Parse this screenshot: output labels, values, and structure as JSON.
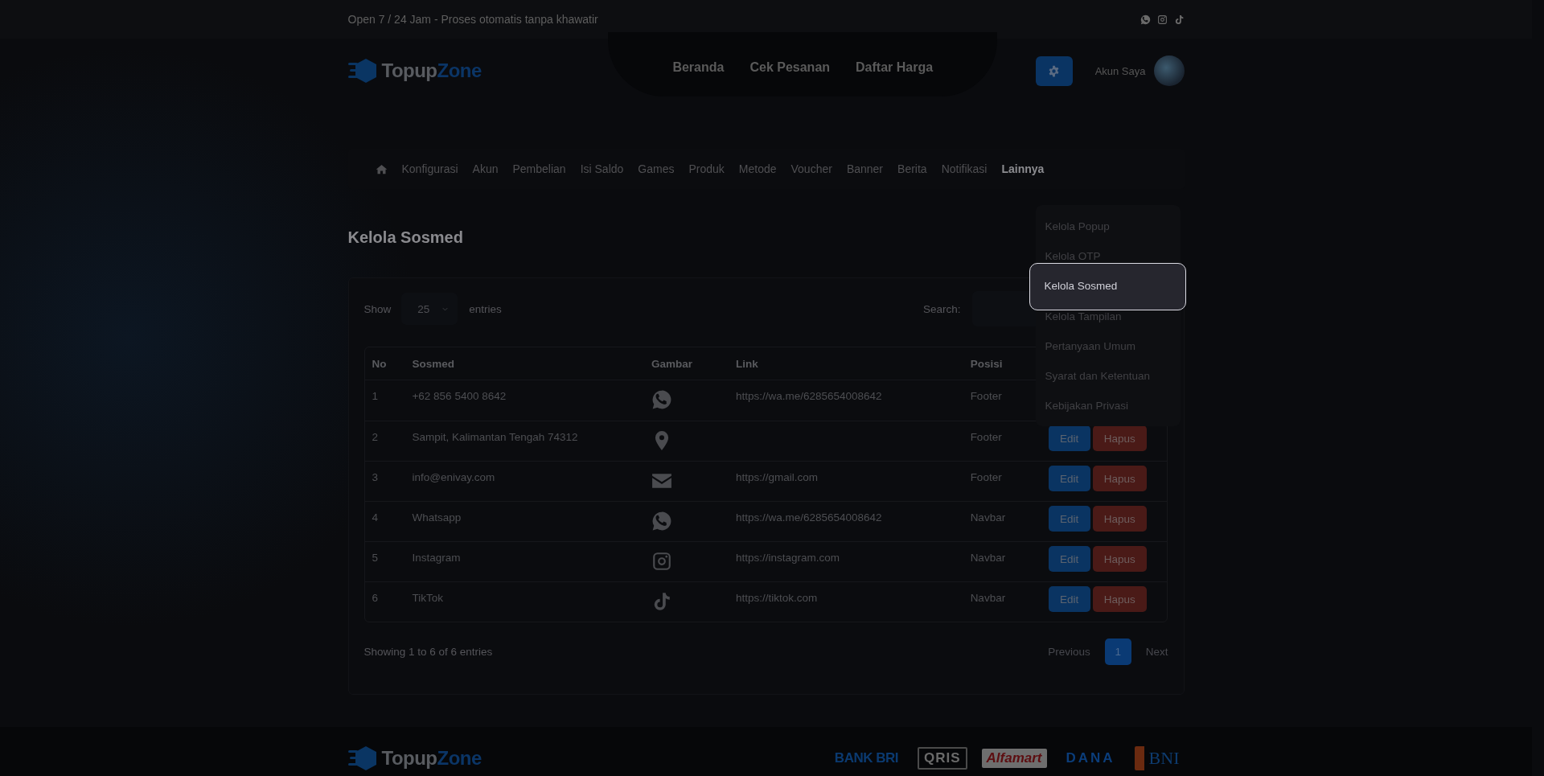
{
  "top_bar": {
    "tagline": "Open 7 / 24 Jam - Proses otomatis tanpa khawatir"
  },
  "header": {
    "logo": [
      "Topup",
      "Zone"
    ],
    "nav_links": [
      "Beranda",
      "Cek Pesanan",
      "Daftar Harga"
    ],
    "account": "Akun Saya"
  },
  "admin_menu": {
    "items": [
      {
        "label": "Konfigurasi",
        "selected": false
      },
      {
        "label": "Akun",
        "selected": false
      },
      {
        "label": "Pembelian",
        "selected": false
      },
      {
        "label": "Isi Saldo",
        "selected": false
      },
      {
        "label": "Games",
        "selected": false
      },
      {
        "label": "Produk",
        "selected": false
      },
      {
        "label": "Metode",
        "selected": false
      },
      {
        "label": "Voucher",
        "selected": false
      },
      {
        "label": "Banner",
        "selected": false
      },
      {
        "label": "Berita",
        "selected": false
      },
      {
        "label": "Notifikasi",
        "selected": false
      },
      {
        "label": "Lainnya",
        "selected": true
      }
    ]
  },
  "dropdown": {
    "items": [
      {
        "label": "Kelola Popup",
        "selected": false
      },
      {
        "label": "Kelola OTP",
        "selected": false
      },
      {
        "label": "Kelola Sosmed",
        "selected": true
      },
      {
        "label": "Kelola Tampilan",
        "selected": false
      },
      {
        "label": "Pertanyaan Umum",
        "selected": false
      },
      {
        "label": "Syarat dan Ketentuan",
        "selected": false
      },
      {
        "label": "Kebijakan Privasi",
        "selected": false
      }
    ]
  },
  "page_title": "Kelola Sosmed",
  "table": {
    "show_label": "Show",
    "entries_value": "25",
    "entries_label": "entries",
    "search_label": "Search:",
    "columns": [
      "No",
      "Sosmed",
      "Gambar",
      "Link",
      "Posisi"
    ],
    "rows": [
      {
        "no": "1",
        "sosmed": "+62 856 5400 8642",
        "kind": "whatsapp",
        "link": "https://wa.me/6285654008642",
        "posisi": "Footer"
      },
      {
        "no": "2",
        "sosmed": "Sampit, Kalimantan Tengah 74312",
        "kind": "location",
        "posisi": "Footer",
        "actions": [
          "Edit",
          "Hapus"
        ]
      },
      {
        "no": "3",
        "sosmed": "info@enivay.com",
        "kind": "email",
        "link": "https://gmail.com",
        "posisi": "Footer",
        "actions": [
          "Edit",
          "Hapus"
        ]
      },
      {
        "no": "4",
        "sosmed": "Whatsapp",
        "kind": "whatsapp",
        "link": "https://wa.me/6285654008642",
        "posisi": "Navbar",
        "actions": [
          "Edit",
          "Hapus"
        ]
      },
      {
        "no": "5",
        "sosmed": "Instagram",
        "kind": "instagram",
        "link": "https://instagram.com",
        "posisi": "Navbar",
        "actions": [
          "Edit",
          "Hapus"
        ]
      },
      {
        "no": "6",
        "sosmed": "TikTok",
        "kind": "tiktok",
        "link": "https://tiktok.com",
        "posisi": "Navbar",
        "actions": [
          "Edit",
          "Hapus"
        ]
      }
    ],
    "info": "Showing 1 to 6 of 6 entries",
    "pagination": {
      "previous": "Previous",
      "pages": [
        {
          "label": "1",
          "selected": true
        }
      ],
      "next": "Next"
    }
  },
  "footer": {
    "logo": [
      "Topup",
      "Zone"
    ],
    "payment_logos": [
      {
        "label": "BANK BRI",
        "kind": "bri"
      },
      {
        "label": "QRIS",
        "kind": "qris"
      },
      {
        "label": "Alfamart",
        "kind": "alfamart"
      },
      {
        "label": "DANA",
        "kind": "dana"
      },
      {
        "label": "BNI",
        "kind": "bni"
      }
    ]
  }
}
